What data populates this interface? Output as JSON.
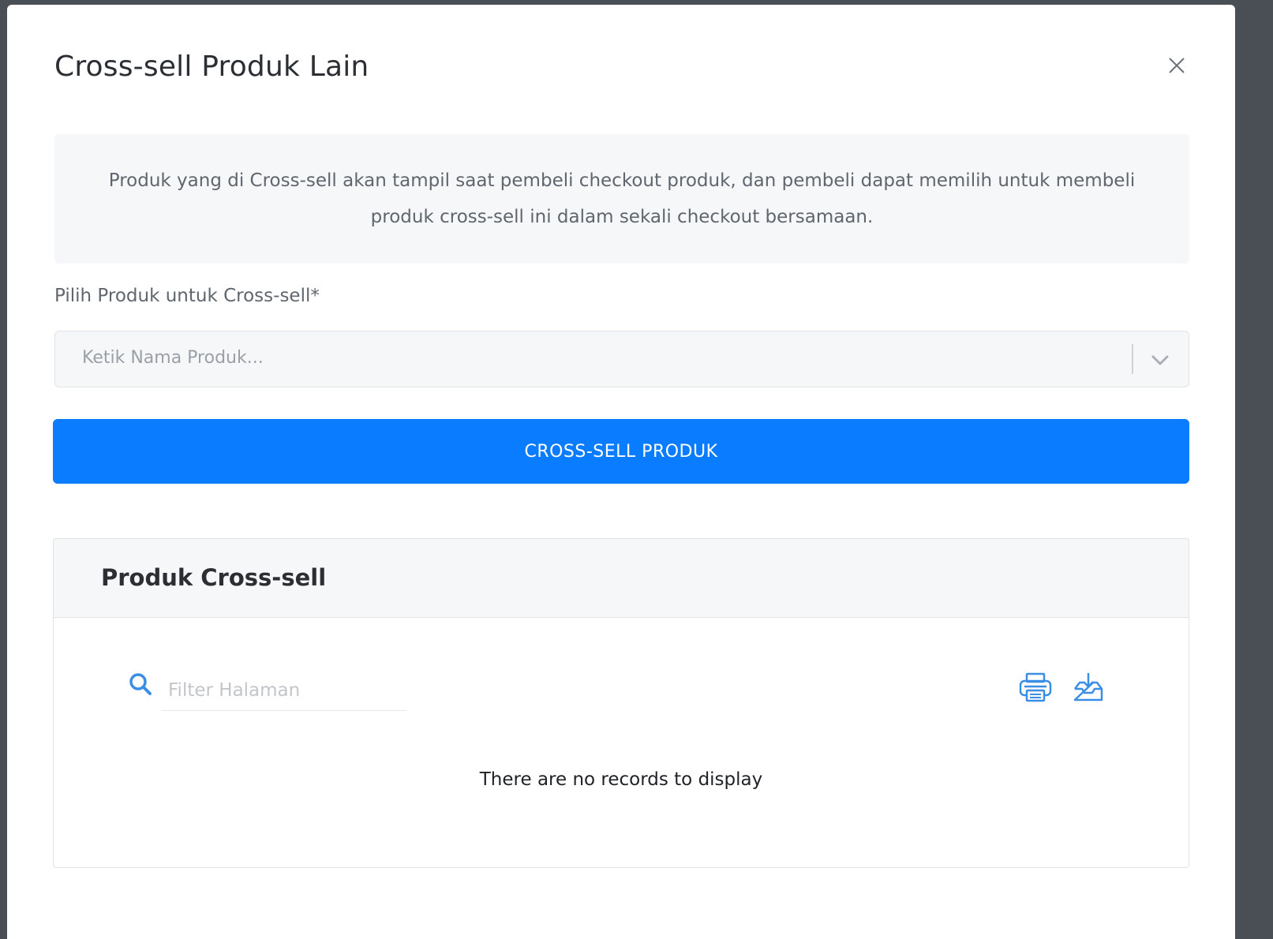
{
  "modal": {
    "title": "Cross-sell Produk Lain",
    "close_icon": "close-icon"
  },
  "info": {
    "text": "Produk yang di Cross-sell akan tampil saat pembeli checkout produk, dan pembeli dapat memilih untuk membeli produk cross-sell ini dalam sekali checkout bersamaan."
  },
  "form": {
    "label": "Pilih Produk untuk Cross-sell*",
    "select_placeholder": "Ketik Nama Produk...",
    "select_icon": "chevron-down-icon",
    "submit_label": "CROSS-SELL PRODUK"
  },
  "table_card": {
    "title": "Produk Cross-sell",
    "filter_placeholder": "Filter Halaman",
    "search_icon": "search-icon",
    "print_icon": "print-icon",
    "download_icon": "download-icon",
    "empty_message": "There are no records to display"
  },
  "colors": {
    "primary": "#0a7cff",
    "icon_blue": "#3a8ee6",
    "panel_bg": "#f6f7f9",
    "overlay": "#4a4e55"
  }
}
